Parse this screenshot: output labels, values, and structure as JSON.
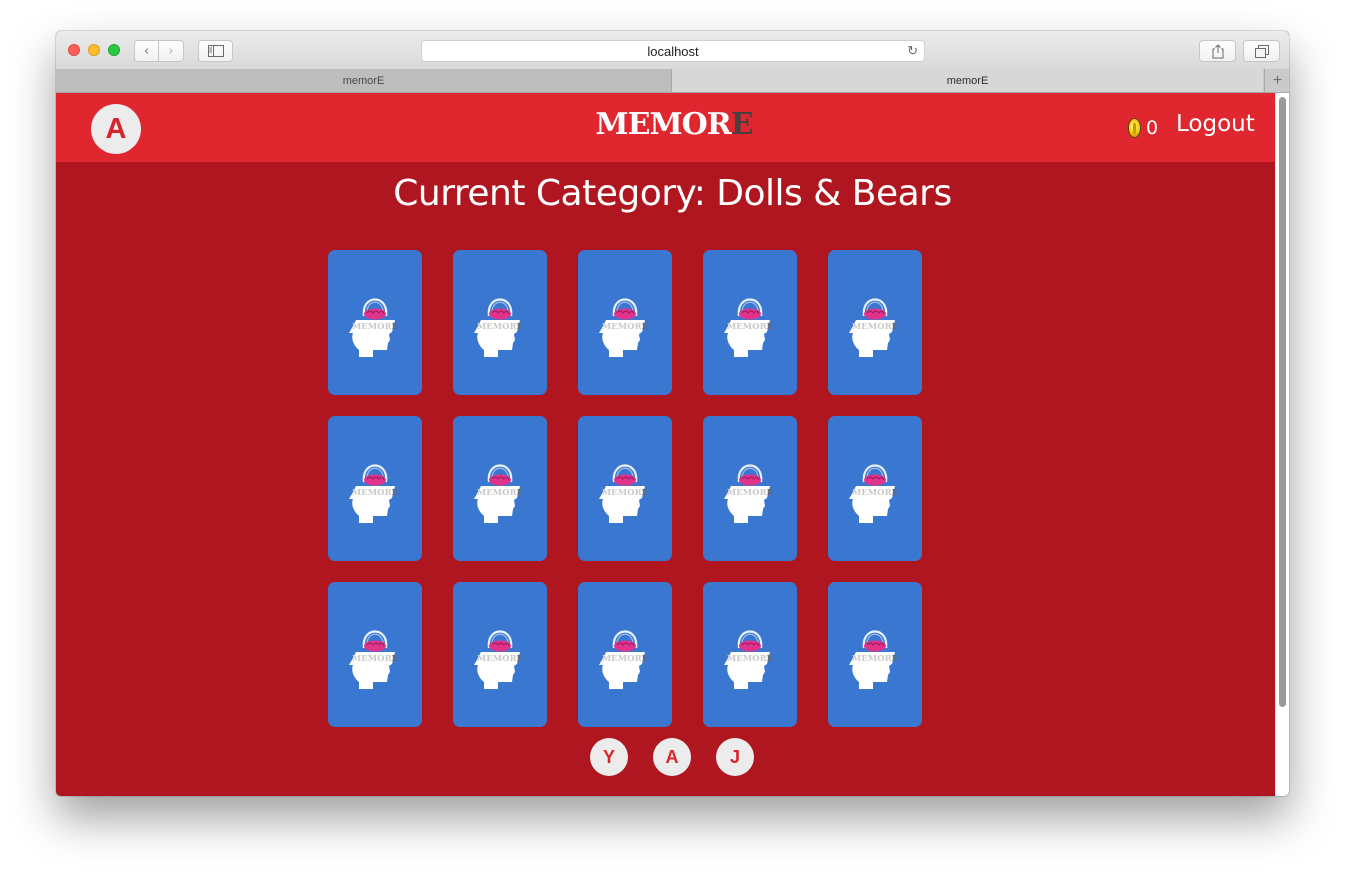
{
  "browser": {
    "url": "localhost",
    "tabs": [
      {
        "label": "memorE"
      },
      {
        "label": "memorE"
      }
    ],
    "new_tab_symbol": "+",
    "back_symbol": "‹",
    "forward_symbol": "›",
    "reload_symbol": "↻"
  },
  "header": {
    "user_initial": "A",
    "logo_main": "MEMOR",
    "logo_accent": "E",
    "coins": "0",
    "logout_label": "Logout"
  },
  "page": {
    "title": "Current Category: Dolls & Bears"
  },
  "cards": {
    "rows": 3,
    "columns": 5,
    "face": "card-back",
    "card_logo_text": "MEMORE",
    "colors": {
      "card": "#3a77d0",
      "background": "#b0161f",
      "header": "#e0262f"
    }
  },
  "players": [
    {
      "initial": "Y"
    },
    {
      "initial": "A"
    },
    {
      "initial": "J"
    }
  ],
  "icons": {
    "coin": "coin-icon",
    "card_art": "brain-head-icon"
  }
}
